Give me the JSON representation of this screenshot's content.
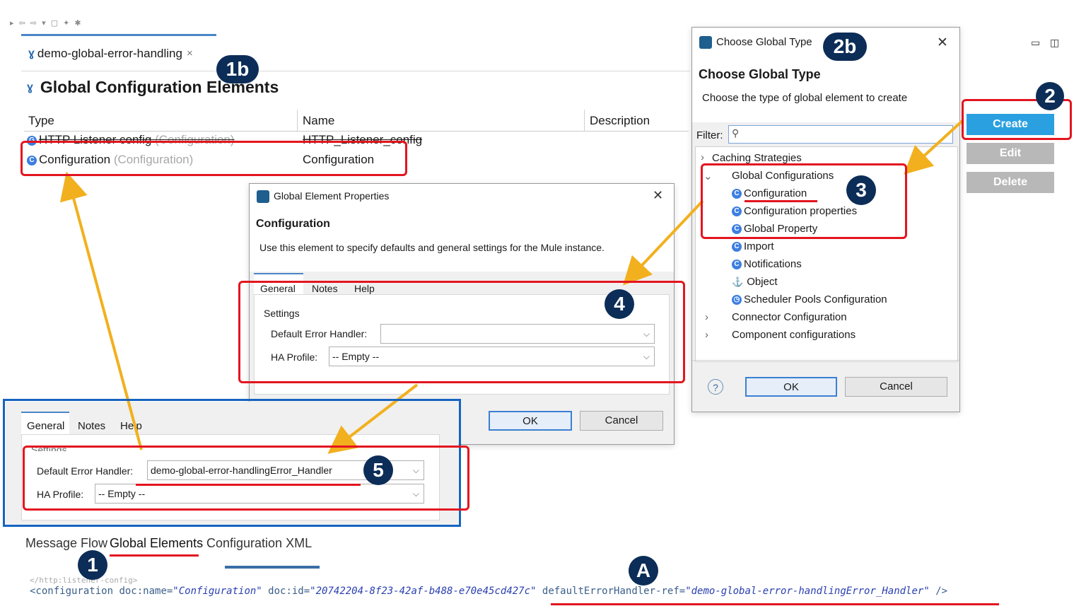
{
  "editor": {
    "tab_label": "demo-global-error-handling",
    "tab_close": "×",
    "section_title": "Global Configuration Elements",
    "columns": [
      "Type",
      "Name",
      "Description"
    ],
    "rows": [
      {
        "type": "HTTP Listener config",
        "type_hint": "(Configuration)",
        "name": "HTTP_Listener_config"
      },
      {
        "type": "Configuration",
        "type_hint": "(Configuration)",
        "name": "Configuration"
      }
    ],
    "bottom_tabs": [
      "Message Flow",
      "Global Elements",
      "Configuration XML"
    ]
  },
  "side_buttons": {
    "create": "Create",
    "edit": "Edit",
    "delete": "Delete"
  },
  "global_element_dialog": {
    "window_title": "Global Element Properties",
    "heading": "Configuration",
    "description": "Use this element to specify defaults and general settings for the Mule instance.",
    "tabs": [
      "General",
      "Notes",
      "Help"
    ],
    "settings_label": "Settings",
    "default_error_handler_label": "Default Error Handler:",
    "default_error_handler_value": "",
    "ha_profile_label": "HA Profile:",
    "ha_profile_value": "-- Empty --",
    "ok": "OK",
    "cancel": "Cancel"
  },
  "detail_panel": {
    "tabs": [
      "General",
      "Notes",
      "Help"
    ],
    "settings_label": "Settings",
    "default_error_handler_label": "Default Error Handler:",
    "default_error_handler_value": "demo-global-error-handlingError_Handler",
    "ha_profile_label": "HA Profile:",
    "ha_profile_value": "-- Empty --"
  },
  "choose_type_dialog": {
    "window_title": "Choose Global Type",
    "heading": "Choose Global Type",
    "description": "Choose the type of global element to create",
    "filter_label": "Filter:",
    "filter_value": "",
    "tree": [
      {
        "label": "Caching Strategies",
        "kind": "collapsed"
      },
      {
        "label": "Global Configurations",
        "kind": "expanded"
      },
      {
        "label": "Configuration",
        "kind": "child"
      },
      {
        "label": "Configuration properties",
        "kind": "child"
      },
      {
        "label": "Global Property",
        "kind": "child"
      },
      {
        "label": "Import",
        "kind": "child"
      },
      {
        "label": "Notifications",
        "kind": "child"
      },
      {
        "label": "Object",
        "kind": "child"
      },
      {
        "label": "Scheduler Pools Configuration",
        "kind": "child"
      },
      {
        "label": "Connector Configuration",
        "kind": "collapsed"
      },
      {
        "label": "Component configurations",
        "kind": "collapsed"
      }
    ],
    "help_glyph": "?",
    "ok": "OK",
    "cancel": "Cancel"
  },
  "callouts": [
    "1",
    "1b",
    "2",
    "2b",
    "3",
    "4",
    "5",
    "A"
  ],
  "xml": {
    "prev_line": "</http:listener-config>",
    "open": "<configuration ",
    "attr1": "doc:name=",
    "val1": "\"Configuration\"",
    "attr2": " doc:id=",
    "val2": "\"20742204-8f23-42af-b488-e70e45cd427c\"",
    "attr3": " defaultErrorHandler-ref=",
    "val3": "\"demo-global-error-handlingError_Handler\"",
    "close": " />"
  },
  "colors": {
    "annotation_red": "#e3151f",
    "annotation_blue": "#1664c0",
    "arrow": "#f2b01e",
    "badge": "#0c2d57",
    "create_button": "#2aa0e0",
    "disabled_button": "#b8b8b8"
  }
}
